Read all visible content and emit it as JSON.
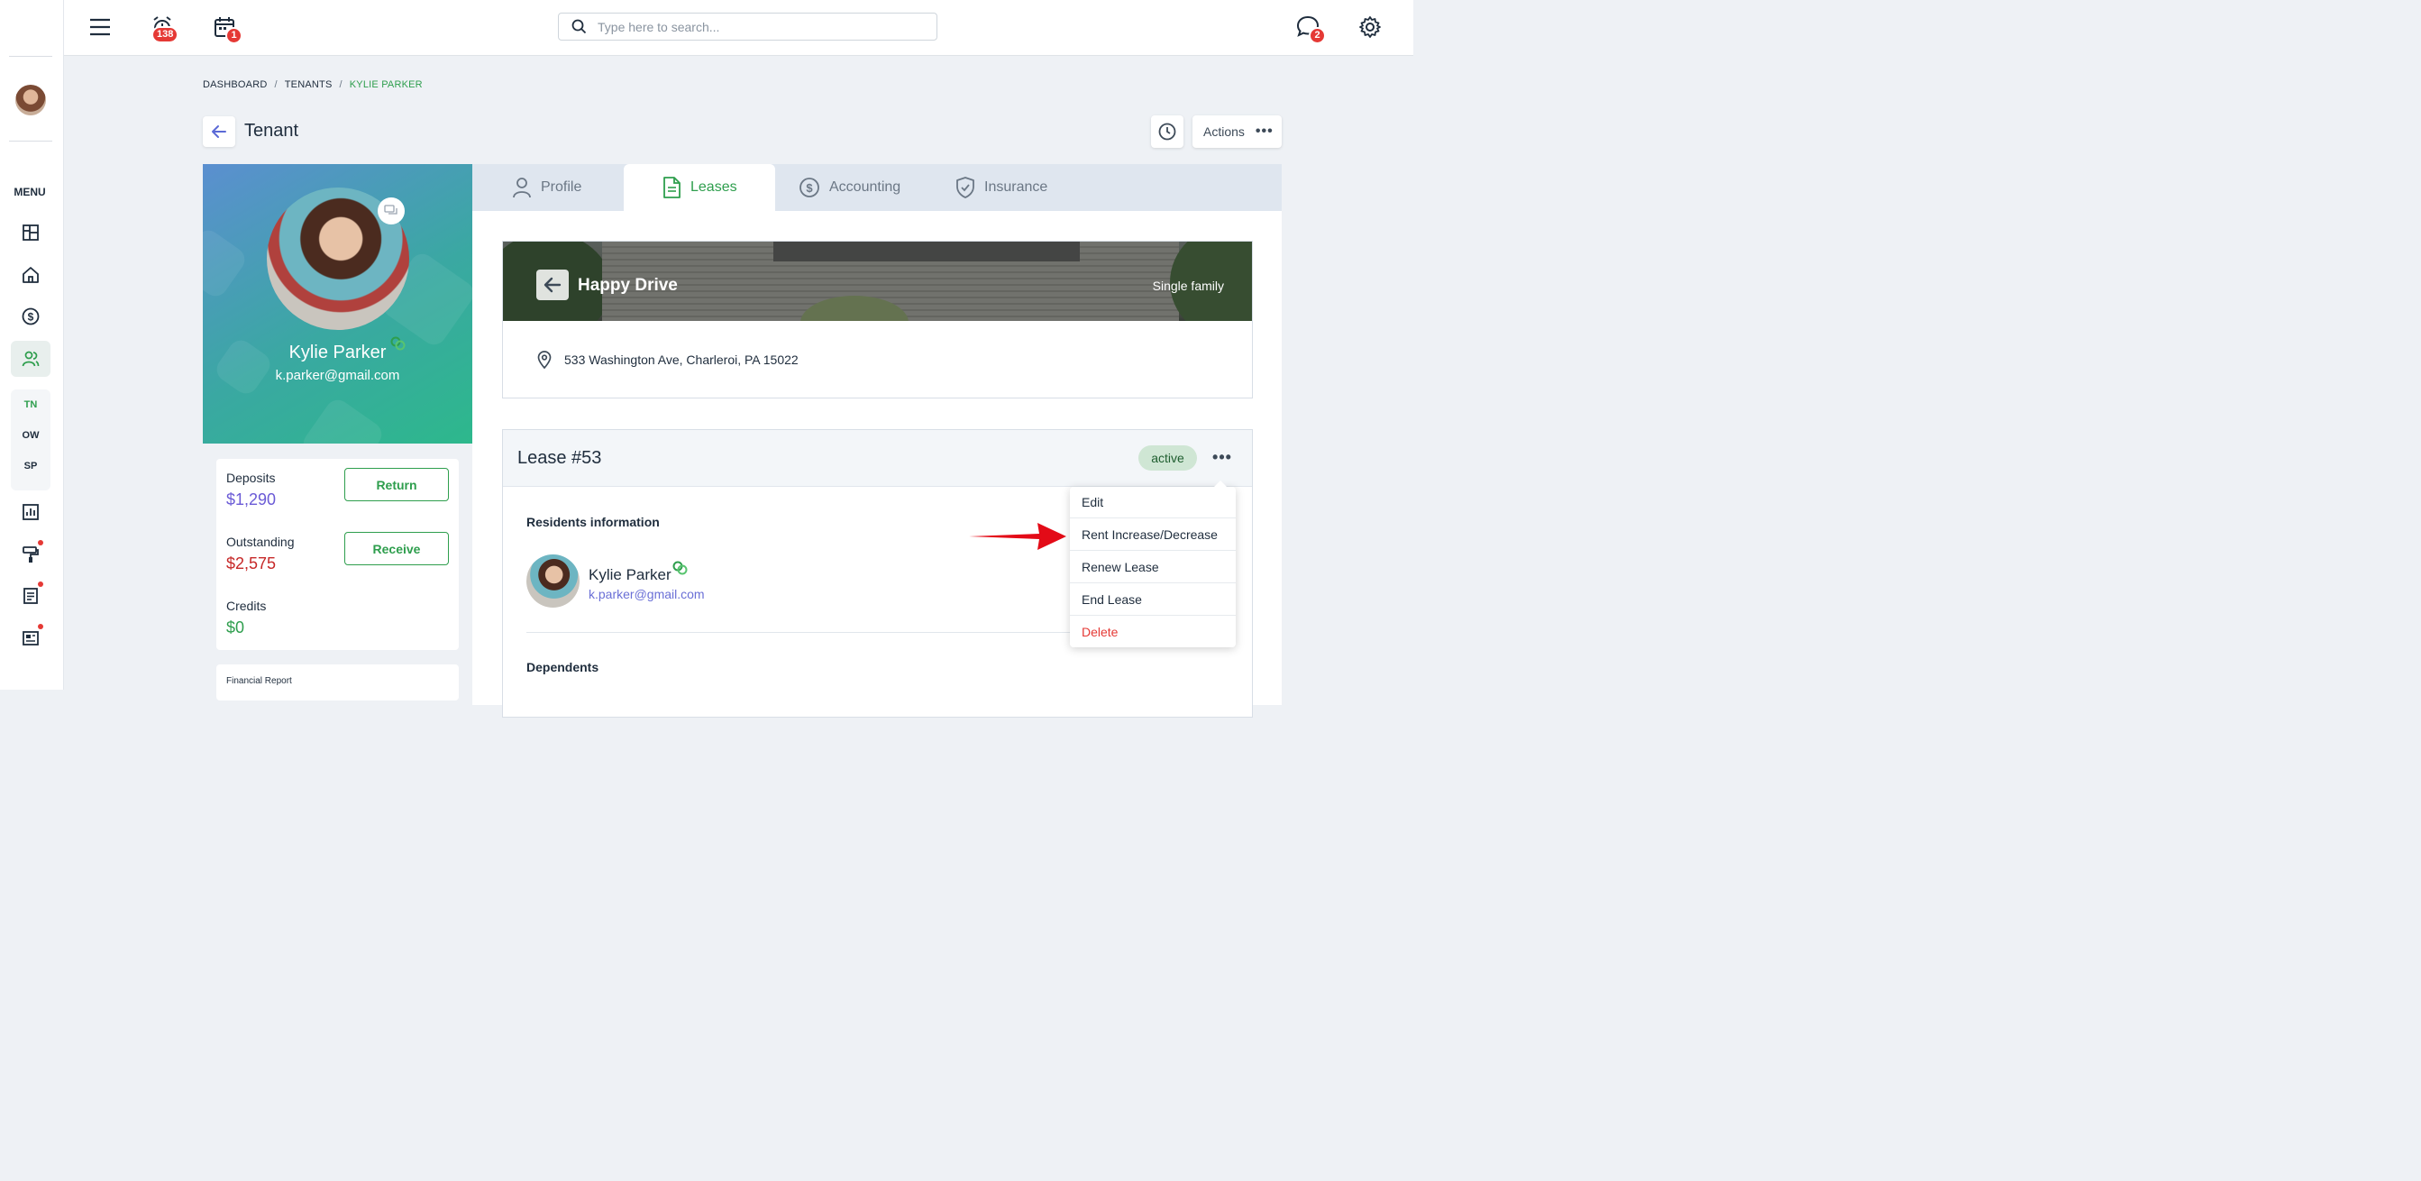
{
  "topbar": {
    "alarm_badge": "138",
    "calendar_badge": "1",
    "chat_badge": "2",
    "search_placeholder": "Type here to search..."
  },
  "sidebar": {
    "menu_label": "MENU",
    "subnav": [
      "TN",
      "OW",
      "SP"
    ]
  },
  "breadcrumb": [
    "DASHBOARD",
    "TENANTS",
    "KYLIE PARKER"
  ],
  "page": {
    "title": "Tenant",
    "actions_label": "Actions"
  },
  "tenant": {
    "name": "Kylie Parker",
    "email": "k.parker@gmail.com"
  },
  "money": {
    "deposits_label": "Deposits",
    "deposits_value": "$1,290",
    "return_label": "Return",
    "outstanding_label": "Outstanding",
    "outstanding_value": "$2,575",
    "receive_label": "Receive",
    "credits_label": "Credits",
    "credits_value": "$0",
    "financial_report_label": "Financial Report"
  },
  "tabs": [
    {
      "label": "Profile",
      "icon": "person-icon"
    },
    {
      "label": "Leases",
      "icon": "document-icon"
    },
    {
      "label": "Accounting",
      "icon": "dollar-icon"
    },
    {
      "label": "Insurance",
      "icon": "shield-icon"
    }
  ],
  "property": {
    "name": "Happy Drive",
    "type": "Single family",
    "address": "533 Washington Ave, Charleroi, PA 15022"
  },
  "lease": {
    "title": "Lease #53",
    "status": "active",
    "residents_title": "Residents information",
    "resident_name": "Kylie Parker",
    "resident_email": "k.parker@gmail.com",
    "dependents_title": "Dependents"
  },
  "dropdown": [
    "Edit",
    "Rent Increase/Decrease",
    "Renew Lease",
    "End Lease",
    "Delete"
  ],
  "colors": {
    "accent_green": "#2e9e4d",
    "badge_red": "#e53935",
    "deposit_purple": "#6a5ad6",
    "outstanding_red": "#c62828"
  }
}
